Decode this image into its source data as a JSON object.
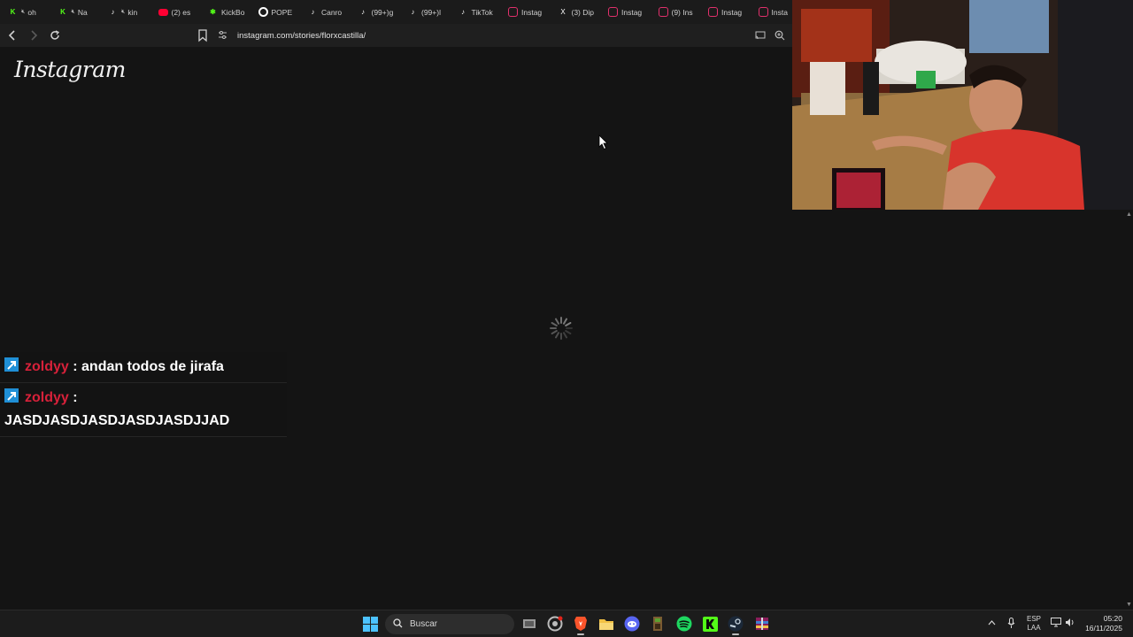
{
  "browser": {
    "tabs": [
      {
        "label": "oh",
        "icon": "kick-icon",
        "color": "#53fc18",
        "muted": true
      },
      {
        "label": "Na",
        "icon": "kick-icon",
        "color": "#53fc18",
        "muted": true
      },
      {
        "label": "kin",
        "icon": "tiktok-icon",
        "color": "#ffffff",
        "muted": true
      },
      {
        "label": "(2) es",
        "icon": "youtube-icon",
        "color": "#ff0033",
        "muted": false
      },
      {
        "label": "KickBo",
        "icon": "kickbot-icon",
        "color": "#53fc18",
        "muted": false
      },
      {
        "label": "POPE",
        "icon": "google-icon",
        "color": "#ffffff",
        "muted": false
      },
      {
        "label": "Canro",
        "icon": "tiktok-icon",
        "color": "#ffffff",
        "muted": false
      },
      {
        "label": "(99+)g",
        "icon": "tiktok-icon",
        "color": "#ffffff",
        "muted": false
      },
      {
        "label": "(99+)l",
        "icon": "tiktok-icon",
        "color": "#ffffff",
        "muted": false
      },
      {
        "label": "TikTok",
        "icon": "tiktok-icon",
        "color": "#ffffff",
        "muted": false
      },
      {
        "label": "Instag",
        "icon": "instagram-icon",
        "color": "#e1306c",
        "muted": false
      },
      {
        "label": "(3) Dip",
        "icon": "x-icon",
        "color": "#ffffff",
        "muted": false
      },
      {
        "label": "Instag",
        "icon": "instagram-icon",
        "color": "#e1306c",
        "muted": false
      },
      {
        "label": "(9) Ins",
        "icon": "instagram-icon",
        "color": "#e1306c",
        "muted": false
      },
      {
        "label": "Instag",
        "icon": "instagram-icon",
        "color": "#e1306c",
        "muted": false
      },
      {
        "label": "Insta",
        "icon": "instagram-icon",
        "color": "#e1306c",
        "muted": false
      }
    ],
    "url": "instagram.com/stories/florxcastilla/"
  },
  "page": {
    "logo": "Instagram",
    "loading": true
  },
  "chat": {
    "messages": [
      {
        "user": "zoldyy",
        "separator": " : ",
        "text": "andan todos de jirafa"
      },
      {
        "user": "zoldyy",
        "separator": " : ",
        "text": "JASDJASDJASDJASDJASDJJAD"
      }
    ]
  },
  "taskbar": {
    "search_placeholder": "Buscar",
    "apps": [
      "task-view-icon",
      "chrome-canary-icon",
      "brave-icon",
      "file-explorer-icon",
      "discord-icon",
      "minecraft-launcher-icon",
      "spotify-icon",
      "kick-icon",
      "steam-icon",
      "winrar-icon"
    ],
    "lang_top": "ESP",
    "lang_bottom": "LAA",
    "time": "05:20",
    "date": "16/11/2025"
  },
  "colors": {
    "background": "#141414",
    "chat_username": "#d8213a",
    "kick_green": "#53fc18",
    "instagram_pink": "#e1306c"
  }
}
